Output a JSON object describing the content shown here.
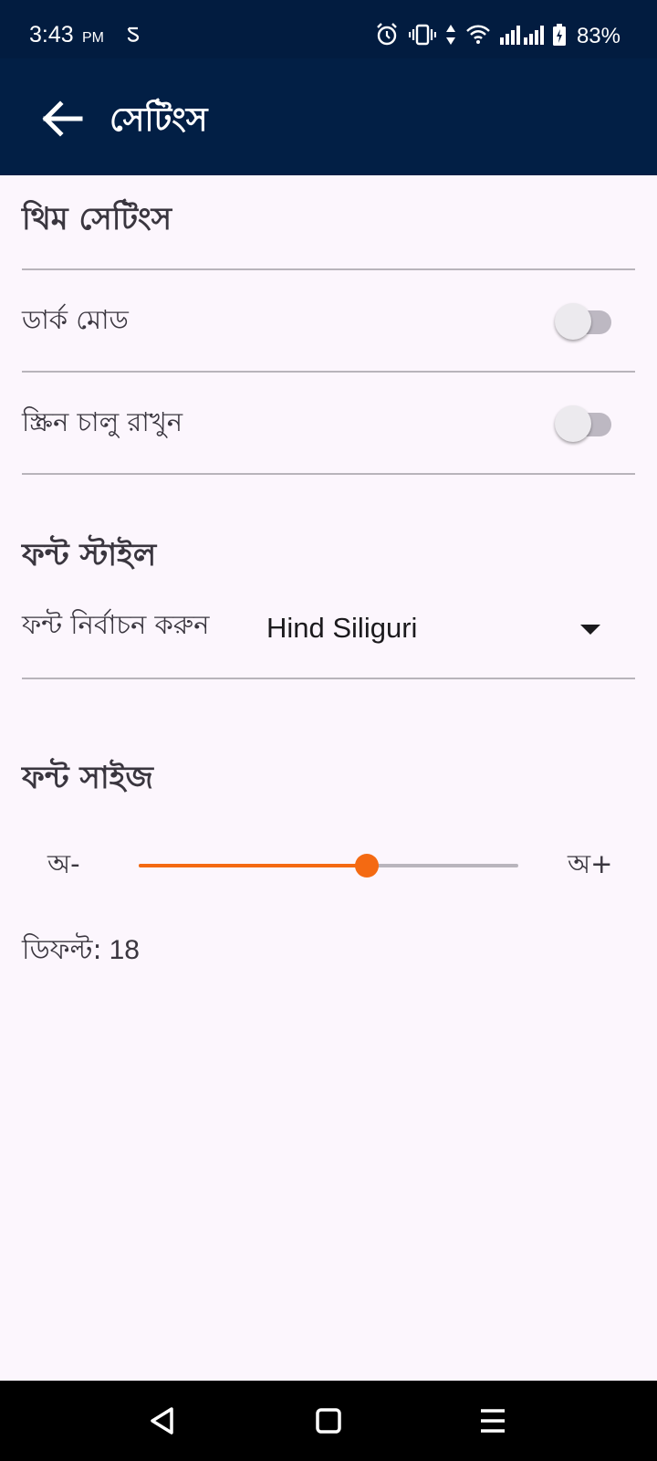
{
  "status_bar": {
    "time": "3:43",
    "ampm": "PM",
    "battery": "83%"
  },
  "app_bar": {
    "title": "সেটিংস"
  },
  "theme_section": {
    "title": "থিম সেটিংস",
    "dark_mode_label": "ডার্ক মোড",
    "dark_mode_on": false,
    "keep_screen_on_label": "স্ক্রিন চালু রাখুন",
    "keep_screen_on_on": false
  },
  "font_style_section": {
    "title": "ফন্ট স্টাইল",
    "select_label": "ফন্ট নির্বাচন করুন",
    "selected_font": "Hind Siliguri"
  },
  "font_size_section": {
    "title": "ফন্ট সাইজ",
    "decrease_label": "অ-",
    "increase_label": "অ+",
    "slider_fraction": 0.6,
    "default_label": "ডিফল্ট:",
    "default_value": "18"
  },
  "colors": {
    "app_bar": "#021f45",
    "accent": "#f46a12",
    "background": "#fcf6fd"
  }
}
